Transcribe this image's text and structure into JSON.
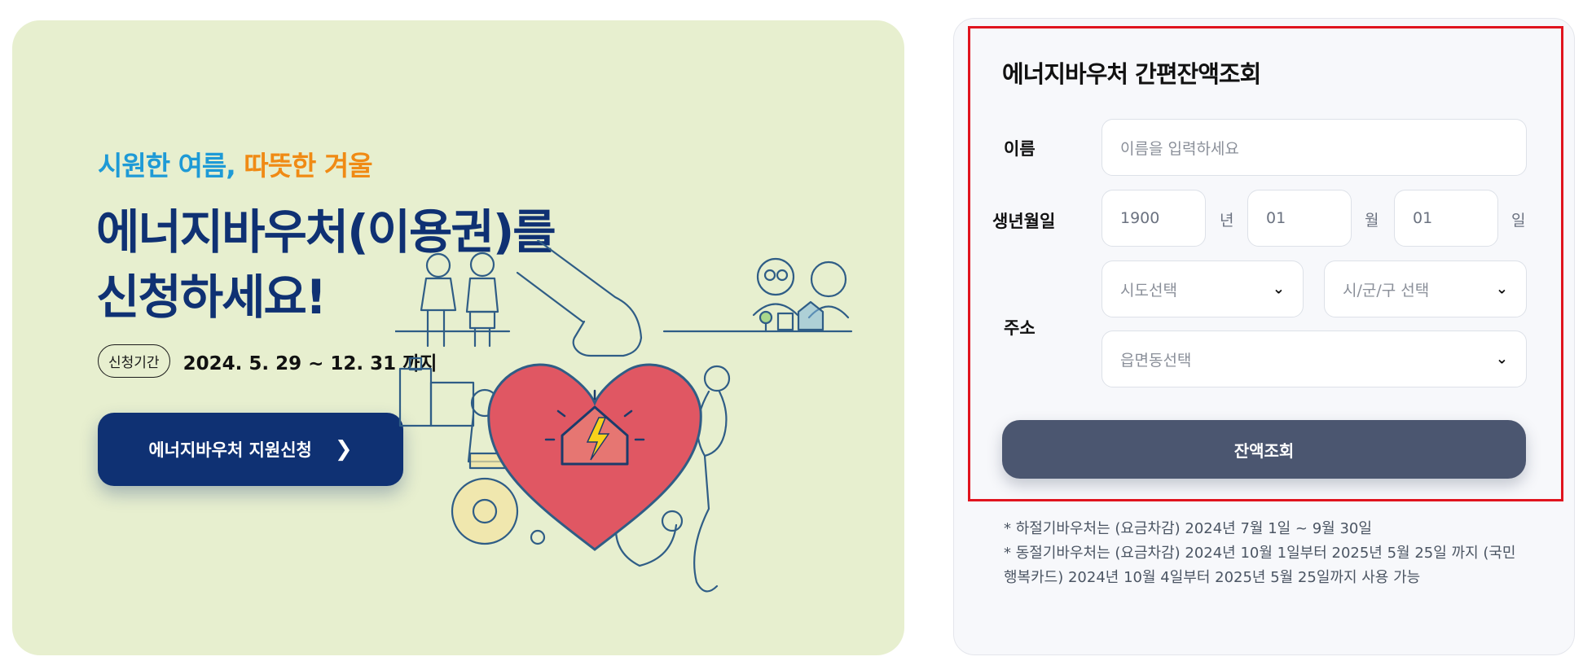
{
  "banner": {
    "tagline_blue": "시원한 여름,",
    "tagline_orange": "따뜻한 겨울",
    "headline_line1": "에너지바우처(이용권)를",
    "headline_line2": "신청하세요!",
    "period_badge": "신청기간",
    "period_text": "2024. 5. 29 ~ 12. 31 까지",
    "apply_button": "에너지바우처 지원신청",
    "apply_chevron": "❯"
  },
  "panel": {
    "title": "에너지바우처 간편잔액조회",
    "name_label": "이름",
    "name_placeholder": "이름을 입력하세요",
    "birth_label": "생년월일",
    "birth_year": "1900",
    "year_unit": "년",
    "birth_month": "01",
    "month_unit": "월",
    "birth_day": "01",
    "day_unit": "일",
    "address_label": "주소",
    "sido_select": "시도선택",
    "sigungu_select": "시/군/구 선택",
    "eupmyeondong_select": "읍면동선택",
    "query_button": "잔액조회",
    "notes": [
      "* 하절기바우처는 (요금차감) 2024년 7월 1일 ~ 9월 30일",
      "* 동절기바우처는 (요금차감) 2024년 10월 1일부터 2025년 5월 25일 까지 (국민행복카드) 2024년 10월 4일부터 2025년 5월 25일까지 사용 가능"
    ]
  },
  "colors": {
    "banner_bg": "#e7efcf",
    "headline": "#0f3173",
    "tag_blue": "#1e9ad6",
    "tag_orange": "#f08a14",
    "query_button": "#4b5670",
    "highlight": "#e0141e",
    "heart": "#e05763"
  },
  "icons": {
    "apply_chevron": "chevron-right-icon",
    "select_caret": "chevron-down-icon",
    "illustration": "energy-heart-illustration"
  }
}
